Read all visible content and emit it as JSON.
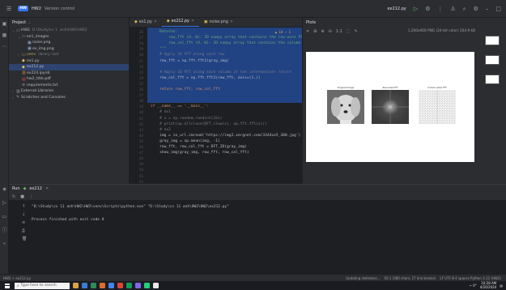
{
  "titlebar": {
    "project_badge": "HW",
    "project_name": "HW2",
    "vcs": "Version control",
    "run_config": "ex212.py"
  },
  "project_panel": {
    "title": "Project",
    "items": [
      {
        "label": "HW2",
        "hint": "D:\\Study\\cv 1 ​ anh\\HW2\\HW2",
        "indent": 0,
        "icon": "folder-icon",
        "expanded": true
      },
      {
        "label": "ex1_images",
        "hint": "",
        "indent": 1,
        "icon": "folder-icon",
        "expanded": true
      },
      {
        "label": "noise.png",
        "hint": "",
        "indent": 2,
        "icon": "image-icon"
      },
      {
        "label": "ex_img.png",
        "hint": "",
        "indent": 2,
        "icon": "image-icon"
      },
      {
        "label": "venv",
        "hint": "library root",
        "indent": 1,
        "icon": "folder-icon",
        "venv": true
      },
      {
        "label": "ex1.py",
        "hint": "",
        "indent": 1,
        "icon": "python-icon"
      },
      {
        "label": "ex212.py",
        "hint": "",
        "indent": 1,
        "icon": "python-icon",
        "selected": true
      },
      {
        "label": "ex224.ipynb",
        "hint": "",
        "indent": 1,
        "icon": "notebook-icon"
      },
      {
        "label": "hw2_title.pdf",
        "hint": "",
        "indent": 1,
        "icon": "pdf-icon"
      },
      {
        "label": "requirements.txt",
        "hint": "",
        "indent": 1,
        "icon": "text-icon"
      },
      {
        "label": "External Libraries",
        "hint": "",
        "indent": 0,
        "icon": "library-icon"
      },
      {
        "label": "Scratches and Consoles",
        "hint": "",
        "indent": 0,
        "icon": "scratch-icon"
      }
    ]
  },
  "tabs": [
    {
      "label": "ex1.py",
      "active": false
    },
    {
      "label": "ex212.py",
      "active": true
    },
    {
      "label": "noise.png",
      "active": false
    }
  ],
  "editor": {
    "warnings": "▲ 14 ✓ 1",
    "line_numbers": [
      "26",
      "27",
      "28",
      "29",
      "30",
      "31",
      "32",
      "33",
      "34",
      "35",
      "36",
      "37",
      "38",
      "39",
      "40",
      "41",
      "42",
      "43",
      "44",
      "45",
      "46",
      "47",
      "48",
      "49",
      "50",
      "51",
      "52"
    ],
    "lines": [
      "    Returns:",
      "        row_fft (H, W): 2D numpy array that contains the row-wise FFT",
      "        row_col_fft (H, W): 2D numpy array that contains the column-wise",
      "    \"\"\"",
      "    # Apply 1D FFT along each row",
      "    row_fft = np.fft.fft2(gray_img)",
      "",
      "    # Apply 1D FFT along each column of the intermediate result",
      "    row_col_fft = np.fft.fft2(row_fft, axis=(1,))",
      "",
      "    return row_fft, row_col_fft",
      "",
      "",
      "if __name__ == '__main__':",
      "    # ex1",
      "    # x = np.random.randint(32x)",
      "    # print(np.allclose(DFT_slow(x), np.fft.fft(x)))",
      "    # ex2",
      "    img = io_url.imread('https://img2.zergnet.com/3344xx5_300.jpg')",
      "    gray_img = np.mean(img, -1)",
      "    row_fft, row_col_fft = DFT_2D(gray_img)",
      "    show_img(gray_img, row_fft, row_col_fft)",
      "",
      "",
      "",
      "",
      ""
    ]
  },
  "plots": {
    "title": "Plots",
    "info": "1,200x400 PNG (24-bit color) 264.9 kB",
    "subplot_titles": [
      "Original Image",
      "Row-wise FFT",
      "Column-wise FFT"
    ]
  },
  "run": {
    "tab_label": "Run",
    "config": "ex212",
    "command": "\"D:\\Study\\cv 11 anh\\HW2\\HW2\\venv\\Scripts\\python.exe\" \"D:\\Study\\cv 11 anh\\HW2\\HW2\\ex212.py\"",
    "exit_msg": "Process finished with exit code 0"
  },
  "status": {
    "path": "HW2 > ex212.py",
    "indexing": "Updating skeletons...",
    "position": "50:1 (580 chars, 17 line breaks)",
    "encoding": "LF  UTF-8  4 spaces  Python 3.12 (HW2)"
  },
  "taskbar": {
    "search_placeholder": "Type here to search",
    "time": "10:28 AM",
    "date": "4/20/2024",
    "temp": "~ 0°"
  },
  "colors": {
    "accent": "#3574f0",
    "selection": "#214283",
    "editor_bg": "#1e1f22",
    "panel_bg": "#2b2d30"
  }
}
